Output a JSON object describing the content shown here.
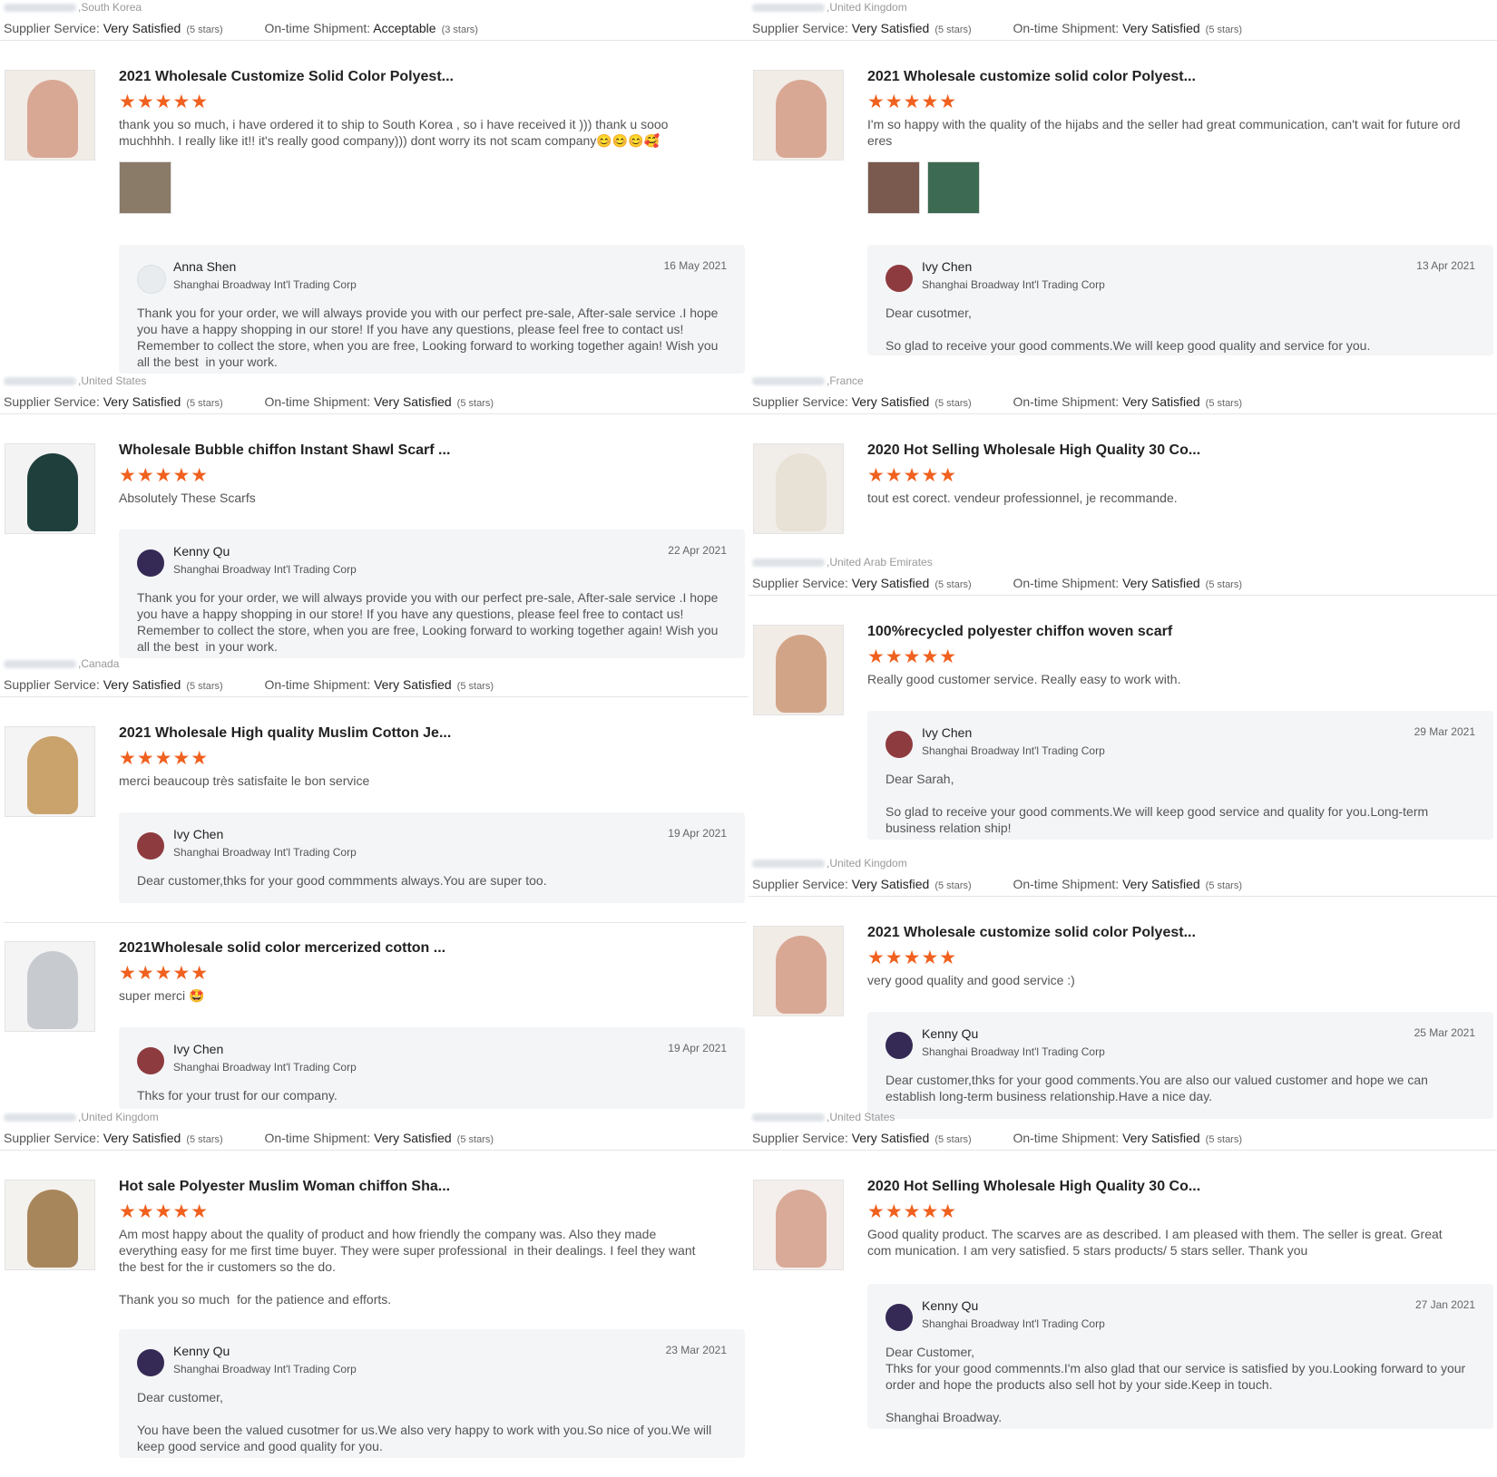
{
  "labels": {
    "supplier_service": "Supplier Service:",
    "ontime_shipment": "On-time Shipment:",
    "replier_company": "Shanghai Broadway Int'l Trading Corp",
    "stars_glyph": "★★★★★"
  },
  "left": [
    {
      "country": "South Korea",
      "supplier_rating": "Very Satisfied",
      "supplier_stars": "(5 stars)",
      "shipment_rating": "Acceptable",
      "shipment_stars": "(3 stars)",
      "product_title": "2021 Wholesale Customize Solid Color Polyest...",
      "rating": 5,
      "review_text": "thank you so much, i have ordered it to ship to South Korea , so i have received it ))) thank u sooo muchhhh. I really like it!! it's really good company))) dont worry its not scam company😊😊😊🥰",
      "photos": 1,
      "reply": {
        "name": "Anna Shen",
        "date": "16 May 2021",
        "text": "Thank you for your order, we will always provide you with our perfect pre-sale, After-sale service .I hope you have a happy shopping in our store! If you have any questions, please feel free to contact us! Remember to collect the store, when you are free, Looking forward to working together again! Wish you all the best  in your work."
      }
    },
    {
      "country": "United States",
      "supplier_rating": "Very Satisfied",
      "supplier_stars": "(5 stars)",
      "shipment_rating": "Very Satisfied",
      "shipment_stars": "(5 stars)",
      "product_title": "Wholesale Bubble chiffon Instant Shawl Scarf ...",
      "rating": 5,
      "review_text": "Absolutely These Scarfs",
      "reply": {
        "name": "Kenny Qu",
        "date": "22 Apr 2021",
        "text": "Thank you for your order, we will always provide you with our perfect pre-sale, After-sale service .I hope you have a happy shopping in our store! If you have any questions, please feel free to contact us! Remember to collect the store, when you are free, Looking forward to working together again! Wish you all the best  in your work."
      }
    },
    {
      "country": "Canada",
      "supplier_rating": "Very Satisfied",
      "supplier_stars": "(5 stars)",
      "shipment_rating": "Very Satisfied",
      "shipment_stars": "(5 stars)",
      "product_title": "2021 Wholesale High quality Muslim Cotton Je...",
      "rating": 5,
      "review_text": "merci beaucoup très satisfaite le bon service",
      "reply": {
        "name": "Ivy Chen",
        "date": "19 Apr 2021",
        "text": "Dear customer,thks for your good commments always.You are super too."
      }
    },
    {
      "product_title": "2021Wholesale solid color mercerized cotton ...",
      "rating": 5,
      "review_text": "super merci 🤩",
      "reply": {
        "name": "Ivy Chen",
        "date": "19 Apr 2021",
        "text": "Thks for your trust for our company."
      }
    },
    {
      "country": "United Kingdom",
      "supplier_rating": "Very Satisfied",
      "supplier_stars": "(5 stars)",
      "shipment_rating": "Very Satisfied",
      "shipment_stars": "(5 stars)",
      "product_title": "Hot sale Polyester Muslim Woman chiffon Sha...",
      "rating": 5,
      "review_text": "Am most happy about the quality of product and how friendly the company was. Also they made everything easy for me first time buyer. They were super professional  in their dealings. I feel they want the best for the ir customers so the do.\n\nThank you so much  for the patience and efforts.",
      "reply": {
        "name": "Kenny Qu",
        "date": "23 Mar 2021",
        "text": "Dear customer,\n\nYou have been the valued cusotmer for us.We also very happy to work with you.So nice of you.We will keep good service and good quality for you."
      }
    }
  ],
  "right": [
    {
      "country": "United Kingdom",
      "supplier_rating": "Very Satisfied",
      "supplier_stars": "(5 stars)",
      "shipment_rating": "Very Satisfied",
      "shipment_stars": "(5 stars)",
      "product_title": "2021 Wholesale customize solid color Polyest...",
      "rating": 5,
      "review_text": "I'm so happy with the quality of the hijabs and the seller had great communication, can't wait for future ord eres",
      "photos": 2,
      "reply": {
        "name": "Ivy Chen",
        "date": "13 Apr 2021",
        "text": "Dear cusotmer,\n\nSo glad to receive your good comments.We will keep good quality and service for you."
      }
    },
    {
      "country": "France",
      "supplier_rating": "Very Satisfied",
      "supplier_stars": "(5 stars)",
      "shipment_rating": "Very Satisfied",
      "shipment_stars": "(5 stars)",
      "product_title": "2020 Hot Selling Wholesale High Quality 30 Co...",
      "rating": 5,
      "review_text": "tout est corect. vendeur professionnel, je recommande."
    },
    {
      "country": "United Arab Emirates",
      "supplier_rating": "Very Satisfied",
      "supplier_stars": "(5 stars)",
      "shipment_rating": "Very Satisfied",
      "shipment_stars": "(5 stars)",
      "product_title": "100%recycled polyester chiffon woven scarf",
      "rating": 5,
      "review_text": "Really good customer service. Really easy to work with.",
      "reply": {
        "name": "Ivy Chen",
        "date": "29 Mar 2021",
        "text": "Dear Sarah,\n\nSo glad to receive your good comments.We will keep good service and quality for you.Long-term business relation ship!"
      }
    },
    {
      "country": "United Kingdom",
      "supplier_rating": "Very Satisfied",
      "supplier_stars": "(5 stars)",
      "shipment_rating": "Very Satisfied",
      "shipment_stars": "(5 stars)",
      "product_title": "2021 Wholesale customize solid color Polyest...",
      "rating": 5,
      "review_text": "very good quality and good service :)",
      "reply": {
        "name": "Kenny Qu",
        "date": "25 Mar 2021",
        "text": "Dear customer,thks for your good comments.You are also our valued customer and hope we can establish long-term business relationship.Have a nice day."
      }
    },
    {
      "country": "United States",
      "supplier_rating": "Very Satisfied",
      "supplier_stars": "(5 stars)",
      "shipment_rating": "Very Satisfied",
      "shipment_stars": "(5 stars)",
      "product_title": "2020 Hot Selling Wholesale High Quality 30 Co...",
      "rating": 5,
      "review_text": "Good quality product. The scarves are as described. I am pleased with them. The seller is great. Great com munication. I am very satisfied. 5 stars products/ 5 stars seller. Thank you",
      "reply": {
        "name": "Kenny Qu",
        "date": "27 Jan 2021",
        "text": "Dear Customer,\nThks for your good commennts.I'm also glad that our service is satisfied by you.Looking forward to your order and hope the products also sell hot by your side.Keep in touch.\n\nShanghai Broadway."
      }
    }
  ],
  "colors": {
    "star": "#f0601e",
    "reply_bg": "#f4f5f7",
    "border": "#e5e5e5"
  }
}
